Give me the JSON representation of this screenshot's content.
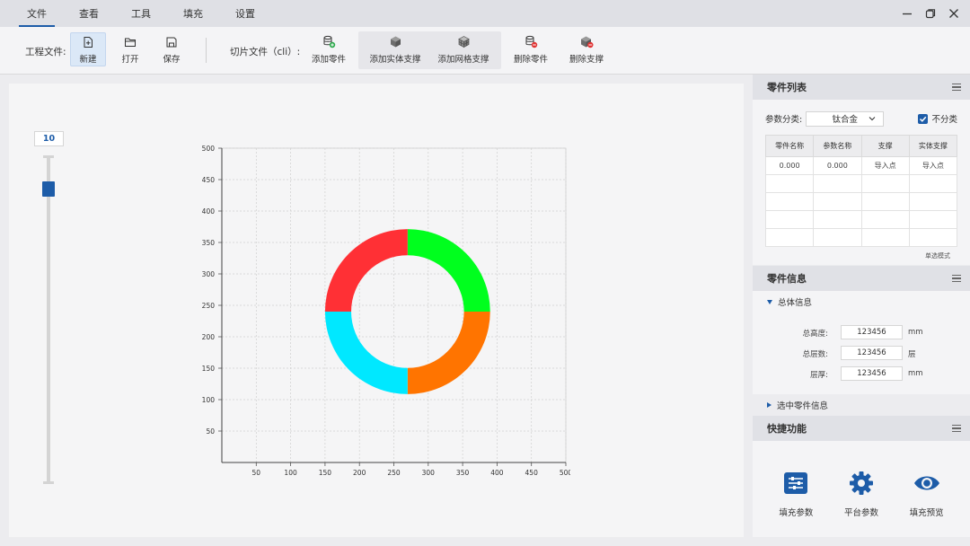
{
  "menu": [
    {
      "label": "文件",
      "active": true
    },
    {
      "label": "查看",
      "active": false
    },
    {
      "label": "工具",
      "active": false
    },
    {
      "label": "填充",
      "active": false
    },
    {
      "label": "设置",
      "active": false
    }
  ],
  "toolbar": {
    "project_label": "工程文件:",
    "new_label": "新建",
    "open_label": "打开",
    "save_label": "保存",
    "slice_label": "切片文件（cli）:",
    "add_part_label": "添加零件",
    "add_solid_support_label": "添加实体支撑",
    "add_grid_support_label": "添加网格支撑",
    "delete_part_label": "删除零件",
    "delete_support_label": "删除支撑"
  },
  "slider": {
    "value": "10",
    "fraction": 0.92
  },
  "chart_data": {
    "type": "pie",
    "variant": "donut",
    "center": [
      270,
      240
    ],
    "outer_radius": 120,
    "inner_radius": 82,
    "xlim": [
      0,
      500
    ],
    "ylim": [
      0,
      500
    ],
    "xticks": [
      "50",
      "100",
      "150",
      "200",
      "250",
      "300",
      "350",
      "400",
      "450",
      "500"
    ],
    "yticks": [
      "50",
      "100",
      "150",
      "200",
      "250",
      "300",
      "350",
      "400",
      "450",
      "500"
    ],
    "grid": true,
    "slices": [
      {
        "value": 25,
        "color": "#00ff1e"
      },
      {
        "value": 25,
        "color": "#ff7400"
      },
      {
        "value": 25,
        "color": "#00e8ff"
      },
      {
        "value": 25,
        "color": "#ff3035"
      }
    ]
  },
  "part_list": {
    "title": "零件列表",
    "category_label": "参数分类:",
    "category_value": "钛合金",
    "no_classify_label": "不分类",
    "columns": [
      "零件名称",
      "参数名称",
      "支撑",
      "实体支撑"
    ],
    "rows": [
      [
        "0.000",
        "0.000",
        "导入点",
        "导入点"
      ],
      [
        "",
        "",
        "",
        ""
      ],
      [
        "",
        "",
        "",
        ""
      ],
      [
        "",
        "",
        "",
        ""
      ],
      [
        "",
        "",
        "",
        ""
      ]
    ],
    "mode_note": "单选模式"
  },
  "part_info": {
    "title": "零件信息",
    "overall_label": "总体信息",
    "fields": [
      {
        "label": "总高度:",
        "value": "123456",
        "unit": "mm"
      },
      {
        "label": "总层数:",
        "value": "123456",
        "unit": "层"
      },
      {
        "label": "层厚:",
        "value": "123456",
        "unit": "mm"
      }
    ],
    "selected_label": "选中零件信息"
  },
  "quick": {
    "title": "快捷功能",
    "items": [
      {
        "label": "填充参数",
        "icon": "sliders-icon"
      },
      {
        "label": "平台参数",
        "icon": "gear-icon"
      },
      {
        "label": "填充预览",
        "icon": "eye-icon"
      }
    ]
  },
  "colors": {
    "accent": "#1d5ca8"
  }
}
